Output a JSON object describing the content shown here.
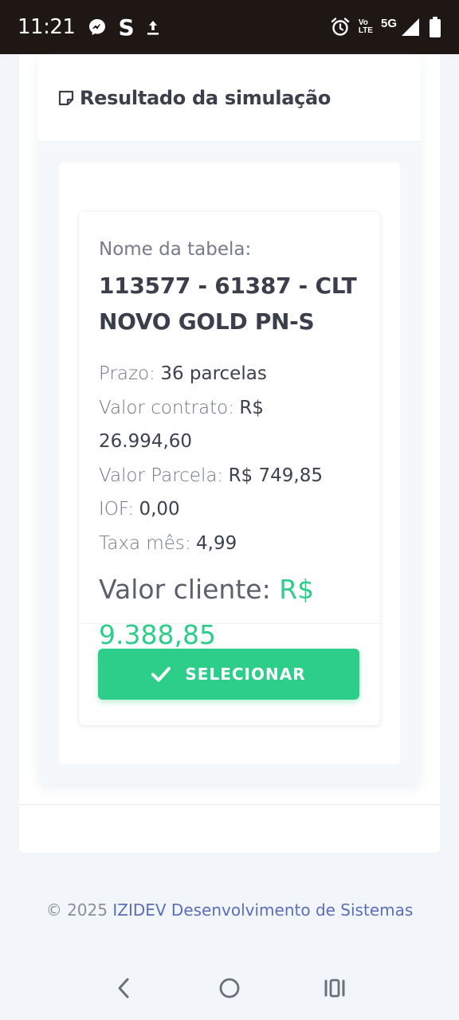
{
  "status_bar": {
    "time": "11:21",
    "left_icons": [
      "messenger-icon",
      "s-app-icon",
      "upload-icon"
    ],
    "volte_line1": "Vo",
    "volte_line2": "LTE",
    "network": "5G",
    "right_icons": [
      "alarm-icon",
      "volte-icon",
      "signal-icon",
      "battery-icon"
    ]
  },
  "header": {
    "icon": "note-icon",
    "title": "Resultado da simulação"
  },
  "result": {
    "table_label": "Nome da tabela:",
    "table_name_line1": "113577 - 61387 - CLT",
    "table_name_line2": "NOVO GOLD PN-S",
    "details": [
      {
        "label": "Prazo:",
        "value": "36 parcelas"
      },
      {
        "label": "Valor contrato:",
        "value": "R$ 26.994,60"
      },
      {
        "label": "Valor Parcela:",
        "value": "R$ 749,85"
      },
      {
        "label": "IOF:",
        "value": "0,00"
      },
      {
        "label": "Taxa mês:",
        "value": "4,99"
      }
    ],
    "client_label": "Valor cliente:",
    "client_currency": "R$",
    "client_value": "9.388,85",
    "select_label": "SELECIONAR",
    "select_icon": "check-icon"
  },
  "footer": {
    "copyright": "© 2025",
    "company": "IZIDEV Desenvolvimento de Sistemas"
  },
  "nav": {
    "icons": [
      "back-icon",
      "home-icon",
      "recents-icon"
    ]
  },
  "colors": {
    "accent_green": "#2dcd8a",
    "company_link": "#5a6fb8",
    "status_bar_bg": "#1e1714"
  }
}
